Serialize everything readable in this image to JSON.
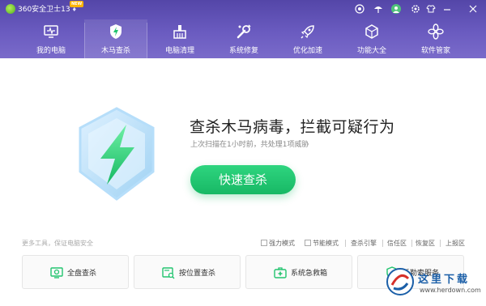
{
  "app": {
    "title": "360安全卫士13",
    "new_badge": "NEW"
  },
  "nav": [
    {
      "label": "我的电脑",
      "icon": "monitor-icon"
    },
    {
      "label": "木马查杀",
      "icon": "shield-lightning-icon",
      "active": true
    },
    {
      "label": "电脑清理",
      "icon": "broom-icon"
    },
    {
      "label": "系统修复",
      "icon": "wrench-icon"
    },
    {
      "label": "优化加速",
      "icon": "rocket-icon"
    },
    {
      "label": "功能大全",
      "icon": "cube-icon"
    },
    {
      "label": "软件管家",
      "icon": "apps-icon"
    }
  ],
  "main": {
    "headline": "查杀木马病毒，拦截可疑行为",
    "subline": "上次扫描在1小时前，共处理1项威胁",
    "scan_button": "快速查杀"
  },
  "tools": {
    "title": "更多工具，保证电脑安全",
    "strong_mode": "强力模式",
    "eco_mode": "节能模式",
    "engine": "查杀引擎",
    "trust_zone": "信任区",
    "restore_zone": "恢复区",
    "report_zone": "上报区"
  },
  "cards": [
    {
      "label": "全盘查杀",
      "icon": "full-scan-icon"
    },
    {
      "label": "按位置查杀",
      "icon": "location-scan-icon"
    },
    {
      "label": "系统急救箱",
      "icon": "first-aid-icon"
    },
    {
      "label": "反勒索服务",
      "icon": "ransom-guard-icon"
    }
  ],
  "watermark": {
    "title": "这里下载",
    "url": "www.herdown.com"
  },
  "colors": {
    "header": "#6454b8",
    "accent_green": "#22c46f"
  }
}
